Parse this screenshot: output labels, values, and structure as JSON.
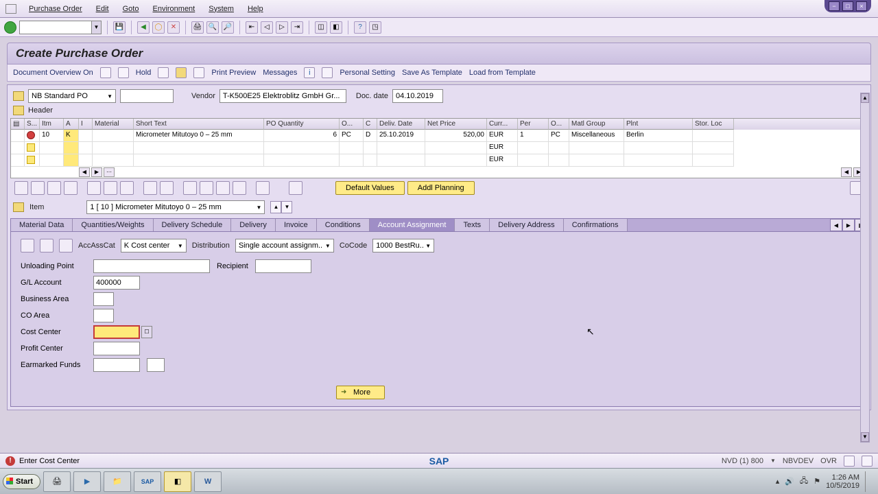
{
  "menu": {
    "m1": "Purchase Order",
    "m2": "Edit",
    "m3": "Goto",
    "m4": "Environment",
    "m5": "System",
    "m6": "Help"
  },
  "title": "Create Purchase Order",
  "apptb": {
    "doc_overview": "Document Overview On",
    "hold": "Hold",
    "print": "Print Preview",
    "messages": "Messages",
    "personal": "Personal Setting",
    "save_tpl": "Save As Template",
    "load_tpl": "Load from Template"
  },
  "doc": {
    "type": "NB Standard PO",
    "num": "",
    "vendor_lbl": "Vendor",
    "vendor": "T-K500E25 Elektroblitz GmbH Gr...",
    "date_lbl": "Doc. date",
    "date": "04.10.2019",
    "header": "Header"
  },
  "grid": {
    "cols": {
      "s": "S...",
      "itm": "Itm",
      "a": "A",
      "i": "I",
      "mat": "Material",
      "st": "Short Text",
      "qty": "PO Quantity",
      "o": "O...",
      "c": "C",
      "deliv": "Deliv. Date",
      "net": "Net Price",
      "cur": "Curr...",
      "per": "Per",
      "opu": "O...",
      "mg": "Matl Group",
      "plnt": "Plnt",
      "stor": "Stor. Loc"
    },
    "rows": [
      {
        "itm": "10",
        "a": "K",
        "st": "Micrometer Mitutoyo 0 – 25 mm",
        "qty": "6",
        "oun": "PC",
        "c": "D",
        "deliv": "25.10.2019",
        "net": "520,00",
        "cur": "EUR",
        "per": "1",
        "opu": "PC",
        "mg": "Miscellaneous",
        "plnt": "Berlin"
      },
      {
        "cur": "EUR"
      },
      {
        "cur": "EUR"
      }
    ]
  },
  "btns": {
    "default": "Default Values",
    "addl": "Addl Planning"
  },
  "item": {
    "lbl": "Item",
    "sel": "1 [ 10 ] Micrometer Mitutoyo 0 – 25 mm"
  },
  "tabs": {
    "t1": "Material Data",
    "t2": "Quantities/Weights",
    "t3": "Delivery Schedule",
    "t4": "Delivery",
    "t5": "Invoice",
    "t6": "Conditions",
    "t7": "Account Assignment",
    "t8": "Texts",
    "t9": "Delivery Address",
    "t10": "Confirmations"
  },
  "aa": {
    "acc_lbl": "AccAssCat",
    "acc": "K Cost center",
    "dist_lbl": "Distribution",
    "dist": "Single account assignm..",
    "co_lbl": "CoCode",
    "co": "1000 BestRu..",
    "unload": "Unloading Point",
    "recip": "Recipient",
    "gl": "G/L Account",
    "gl_val": "400000",
    "ba": "Business Area",
    "coa": "CO Area",
    "cc": "Cost Center",
    "pc": "Profit Center",
    "ef": "Earmarked Funds",
    "more": "More"
  },
  "status": {
    "msg": "Enter Cost Center",
    "sys": "NVD (1) 800",
    "srv": "NBVDEV",
    "mode": "OVR"
  },
  "taskbar": {
    "start": "Start",
    "time": "1:26 AM",
    "date": "10/5/2019"
  }
}
